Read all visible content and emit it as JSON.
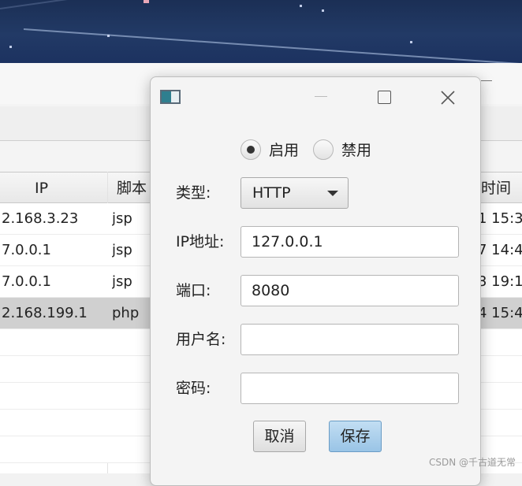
{
  "table": {
    "headers": {
      "ip": "IP",
      "script": "脚本",
      "time": "时间"
    },
    "rows": [
      {
        "ip": "2.168.3.23",
        "script": "jsp",
        "time": "1 15:3"
      },
      {
        "ip": "7.0.0.1",
        "script": "jsp",
        "time": "7 14:4"
      },
      {
        "ip": "7.0.0.1",
        "script": "jsp",
        "time": "3 19:1"
      },
      {
        "ip": "2.168.199.1",
        "script": "php",
        "time": "4 15:4"
      }
    ],
    "selected_row": 3
  },
  "dialog": {
    "radios": [
      {
        "label": "启用",
        "checked": true
      },
      {
        "label": "禁用",
        "checked": false
      }
    ],
    "type_label": "类型:",
    "type_value": "HTTP",
    "ip_label": "IP地址:",
    "ip_value": "127.0.0.1",
    "port_label": "端口:",
    "port_value": "8080",
    "username_label": "用户名:",
    "username_value": "",
    "password_label": "密码:",
    "password_value": "",
    "cancel_label": "取消",
    "save_label": "保存"
  },
  "icons": {
    "app": "app-window-icon",
    "minimize": "minimize-icon",
    "maximize": "maximize-icon",
    "close": "close-icon",
    "dropdown": "chevron-down-icon"
  },
  "colors": {
    "save_button": "#a8cdea",
    "selected_row": "#d0d0d0"
  },
  "watermark": "CSDN @千古道无常"
}
